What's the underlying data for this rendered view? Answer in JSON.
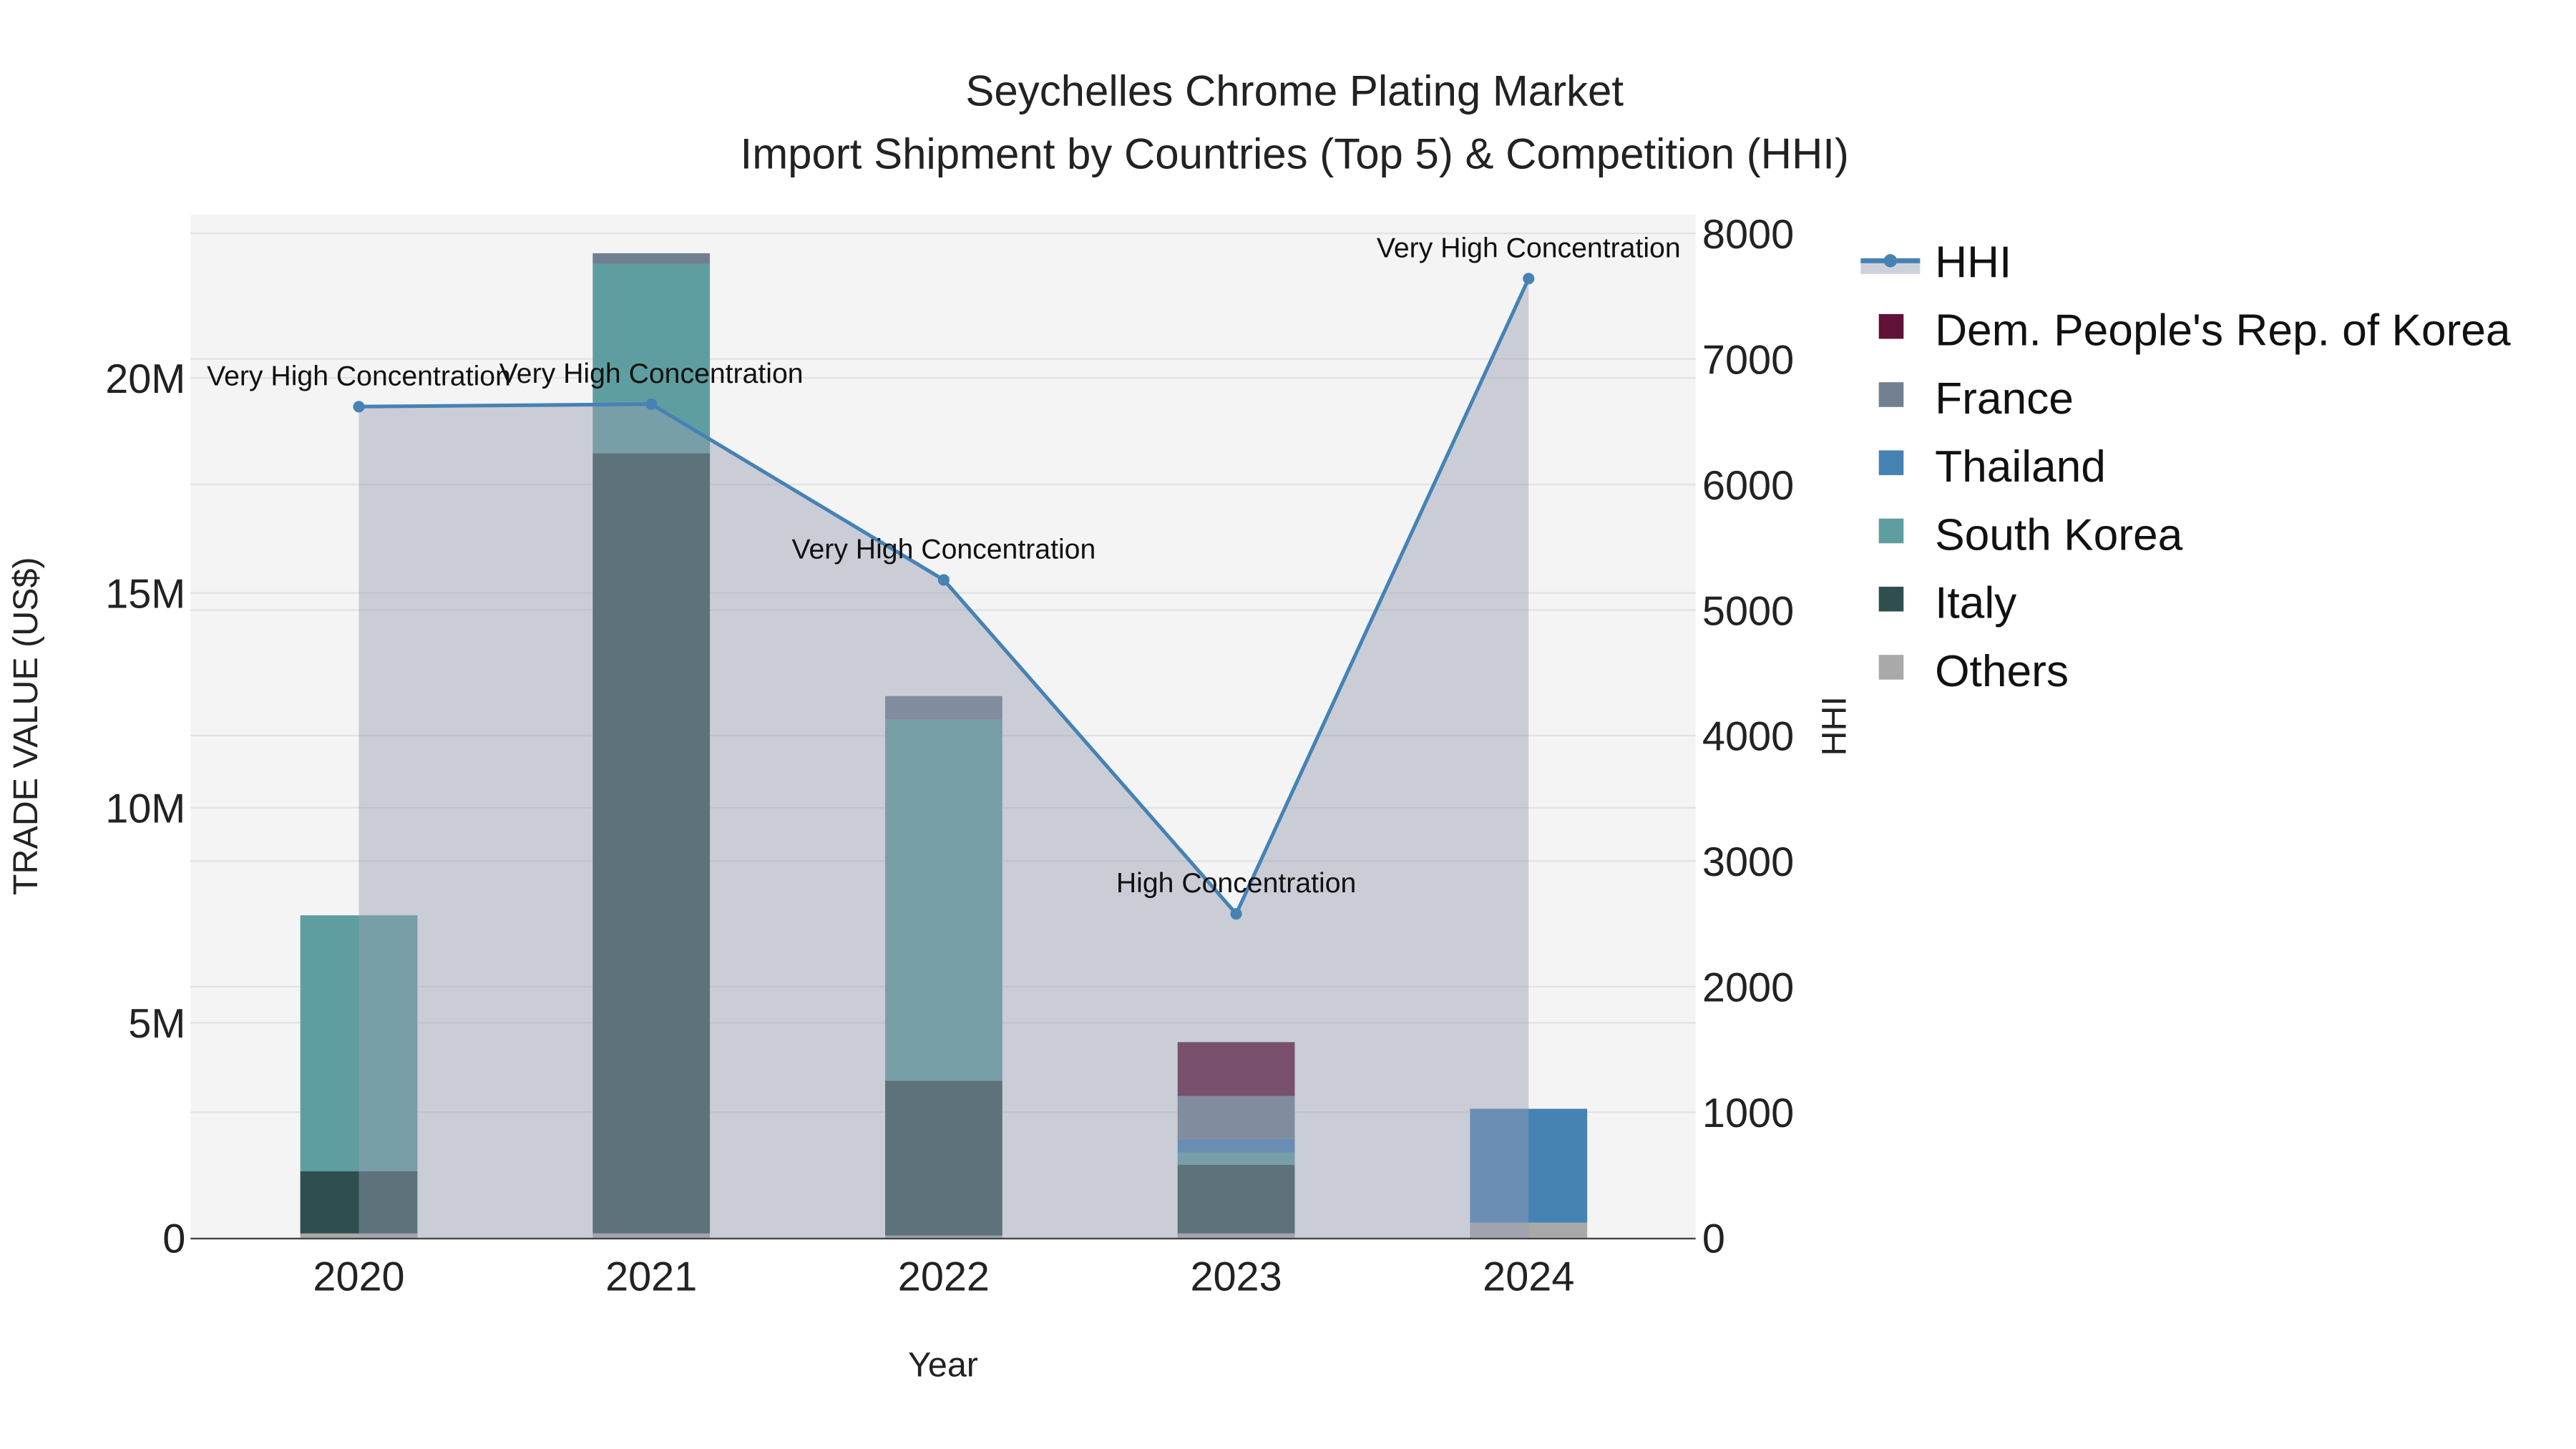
{
  "chart_data": {
    "type": "bar",
    "title": "Seychelles Chrome Plating Market",
    "subtitle": "Import Shipment by Countries (Top 5) & Competition (HHI)",
    "xlabel": "Year",
    "ylabel": "TRADE VALUE (US$)",
    "y2label": "HHI",
    "categories": [
      "2020",
      "2021",
      "2022",
      "2023",
      "2024"
    ],
    "ylim": [
      0,
      23800000
    ],
    "y_ticks": [
      0,
      5000000,
      10000000,
      15000000,
      20000000
    ],
    "y_tick_labels": [
      "0",
      "5M",
      "10M",
      "15M",
      "20M"
    ],
    "y2lim": [
      0,
      8150
    ],
    "y2_ticks": [
      0,
      1000,
      2000,
      3000,
      4000,
      5000,
      6000,
      7000,
      8000
    ],
    "y2_tick_labels": [
      "0",
      "1000",
      "2000",
      "3000",
      "4000",
      "5000",
      "6000",
      "7000",
      "8000"
    ],
    "grid": true,
    "legend_position": "right",
    "series": [
      {
        "name": "Others",
        "color": "#a9a9a9",
        "values": [
          100000,
          100000,
          50000,
          100000,
          350000
        ]
      },
      {
        "name": "Italy",
        "color": "#2f4f4f",
        "values": [
          1450000,
          18150000,
          3600000,
          1600000,
          0
        ]
      },
      {
        "name": "South Korea",
        "color": "#5f9ea0",
        "values": [
          5950000,
          4400000,
          8400000,
          280000,
          0
        ]
      },
      {
        "name": "Thailand",
        "color": "#4682b4",
        "values": [
          0,
          0,
          0,
          320000,
          2650000
        ]
      },
      {
        "name": "France",
        "color": "#708090",
        "values": [
          0,
          250000,
          550000,
          1000000,
          0
        ]
      },
      {
        "name": "Dem. People's Rep. of Korea",
        "color": "#601237",
        "values": [
          0,
          0,
          0,
          1250000,
          0
        ]
      }
    ],
    "hhi": {
      "name": "HHI",
      "color": "#4682b4",
      "values": [
        6620,
        6640,
        5240,
        2580,
        7640
      ],
      "annotations": [
        "Very High Concentration",
        "Very High Concentration",
        "Very High Concentration",
        "High Concentration",
        "Very High Concentration"
      ]
    },
    "legend_order": [
      "HHI",
      "Dem. People's Rep. of Korea",
      "France",
      "Thailand",
      "South Korea",
      "Italy",
      "Others"
    ]
  }
}
